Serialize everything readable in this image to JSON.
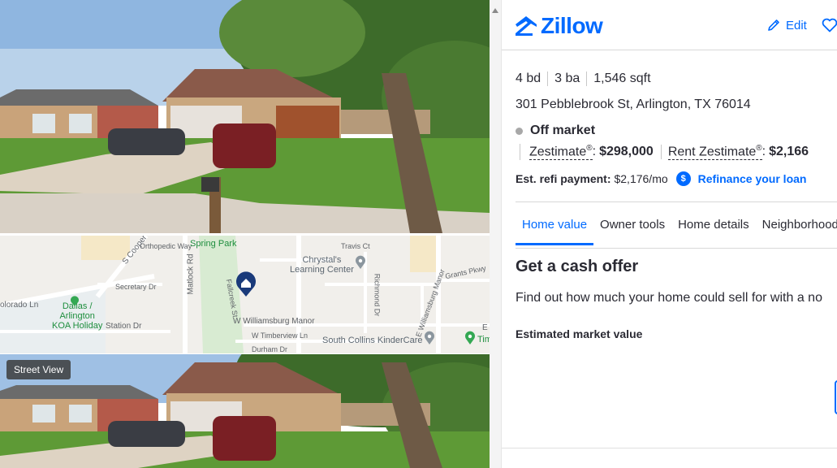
{
  "media": {
    "street_view_badge": "Street View",
    "map": {
      "labels": {
        "s_cooper": "S Cooper",
        "orthopedic_way": "Orthopedic Way",
        "matlock_rd": "Matlock Rd",
        "secretary_dr": "Secretary Dr",
        "colorado_ln": "olorado Ln",
        "station_dr": "Station Dr",
        "spring_park": "Spring Park",
        "fallcreek_st": "Fallcreek St",
        "w_williamsburg_manor": "W Williamsburg Manor",
        "w_timberview_ln": "W Timberview Ln",
        "durham_dr": "Durham Dr",
        "travis_ct": "Travis Ct",
        "chrystals_line1": "Chrystal's",
        "chrystals_line2": "Learning Center",
        "richmond_dr": "Richmond Dr",
        "e_williamsburg_manor": "E Williamsburg Manor",
        "grants_pkwy": "Grants Pkwy",
        "south_collins": "South Collins KinderCare",
        "dallas_koa_line1": "Dallas /",
        "dallas_koa_line2": "Arlington",
        "dallas_koa_line3": "KOA Holiday",
        "tim": "Tim",
        "e_label": "E"
      }
    }
  },
  "header": {
    "brand": "Zillow",
    "edit_label": "Edit",
    "icons": {
      "logo": "zillow-logo-icon",
      "edit": "pencil-icon",
      "save": "heart-icon"
    },
    "accent_color": "#006aff"
  },
  "summary": {
    "beds": "4 bd",
    "baths": "3 ba",
    "sqft": "1,546 sqft",
    "address": "301 Pebblebrook St, Arlington, TX 76014",
    "status": "Off market",
    "status_color": "#a8a8a8",
    "zestimate_label": "Zestimate",
    "zestimate_reg": "®",
    "zestimate_sep": ":",
    "zestimate_value": "$298,000",
    "rent_zestimate_label": "Rent Zestimate",
    "rent_zestimate_reg": "®",
    "rent_zestimate_sep": ":",
    "rent_zestimate_value": "$2,166",
    "refi_label": "Est. refi payment:",
    "refi_value": "$2,176/mo",
    "refi_icon": "$",
    "refi_link": "Refinance your loan"
  },
  "tabs": [
    {
      "label": "Home value",
      "active": true
    },
    {
      "label": "Owner tools",
      "active": false
    },
    {
      "label": "Home details",
      "active": false
    },
    {
      "label": "Neighborhood",
      "active": false
    }
  ],
  "cash_offer": {
    "title": "Get a cash offer",
    "description": "Find out how much your home could sell for with a no",
    "estimated_market_value_label": "Estimated market value"
  }
}
